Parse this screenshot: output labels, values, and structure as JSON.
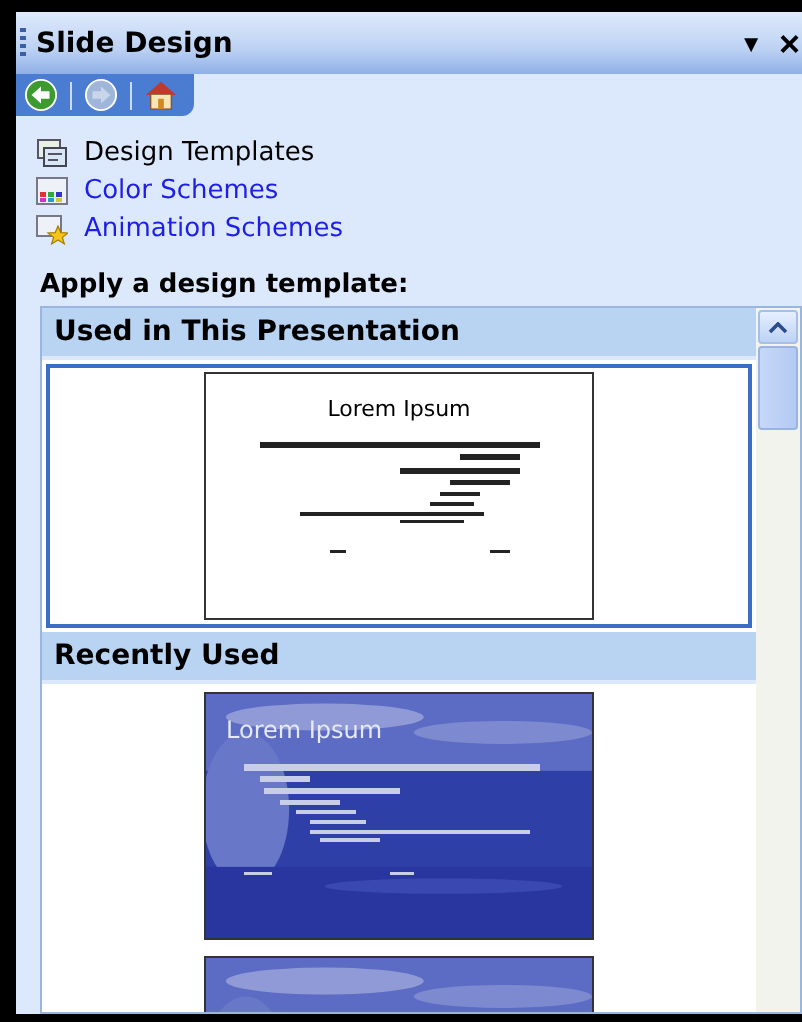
{
  "panel": {
    "title": "Slide Design",
    "menu_glyph": "▼",
    "close_glyph": "×"
  },
  "nav": [
    {
      "kind": "back",
      "disabled": false
    },
    {
      "kind": "forward",
      "disabled": true
    },
    {
      "kind": "home",
      "disabled": false
    }
  ],
  "links": [
    {
      "kind": "templates",
      "label": "Design Templates",
      "selected": true
    },
    {
      "kind": "colors",
      "label": "Color Schemes",
      "selected": false
    },
    {
      "kind": "animation",
      "label": "Animation Schemes",
      "selected": false
    }
  ],
  "section_label": "Apply a design template:",
  "groups": [
    {
      "title": "Used in This Presentation",
      "templates": [
        {
          "kind": "plain",
          "title": "Lorem Ipsum",
          "selected": true
        }
      ]
    },
    {
      "title": "Recently Used",
      "templates": [
        {
          "kind": "sky",
          "title": "Lorem Ipsum",
          "selected": false
        },
        {
          "kind": "sky",
          "selected": false
        }
      ]
    }
  ]
}
